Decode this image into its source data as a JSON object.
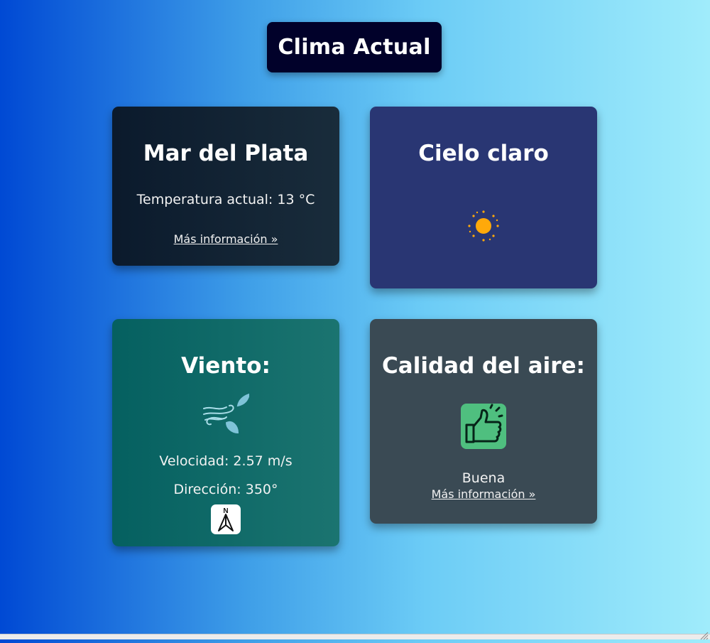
{
  "header": {
    "title": "Clima Actual"
  },
  "city_card": {
    "city": "Mar del Plata",
    "temperature_text": "Temperatura actual: 13 °C",
    "more_info": "Más información »"
  },
  "sky_card": {
    "description": "Cielo claro",
    "icon": "sun-icon"
  },
  "wind_card": {
    "title": "Viento:",
    "icon": "wind-leaves-icon",
    "speed_text": "Velocidad: 2.57 m/s",
    "direction_text": "Dirección: 350°",
    "direction_icon": "north-arrow-icon",
    "direction_letter": "N"
  },
  "air_card": {
    "title": "Calidad del aire:",
    "icon": "thumbs-up-icon",
    "quality": "Buena",
    "more_info": "Más información »",
    "colors": {
      "icon_bg": "#4fbf7f"
    }
  }
}
